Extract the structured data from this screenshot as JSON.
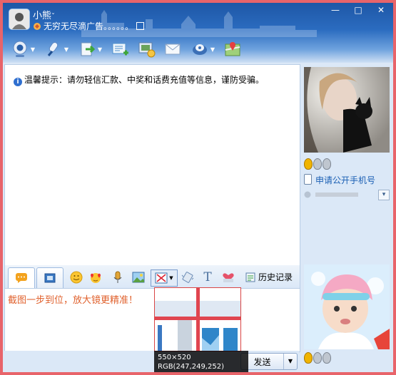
{
  "header": {
    "nickname": "小熊",
    "nickname_caret": "ˇ",
    "signature": "无穷无尽滴广告。。。。。。",
    "window_buttons": [
      "—",
      "□",
      "✕"
    ]
  },
  "toolbar": {
    "items": [
      "video-call",
      "voice-call",
      "send-file",
      "create-discussion",
      "remote-assist",
      "send-mail",
      "app-box",
      "map"
    ]
  },
  "chat": {
    "notice": "温馨提示：请勿轻信汇款、中奖和话费充值等信息，谨防受骗。"
  },
  "input_toolbar": {
    "history_label": "历史记录"
  },
  "input": {
    "text": "截图一步到位，放大镜更精准！"
  },
  "magnifier": {
    "size_text": "550×520",
    "rgb_text": "RGB(247,249,252)"
  },
  "send": {
    "label": "发送",
    "menu_caret": "▼"
  },
  "profile": {
    "phone_link": "申请公开手机号",
    "status_dropdown": "▾"
  },
  "colors": {
    "accent_blue": "#2b6cc0",
    "frame_red": "#e8646a",
    "input_orange": "#e0612d",
    "link_blue": "#1a5fb4"
  }
}
